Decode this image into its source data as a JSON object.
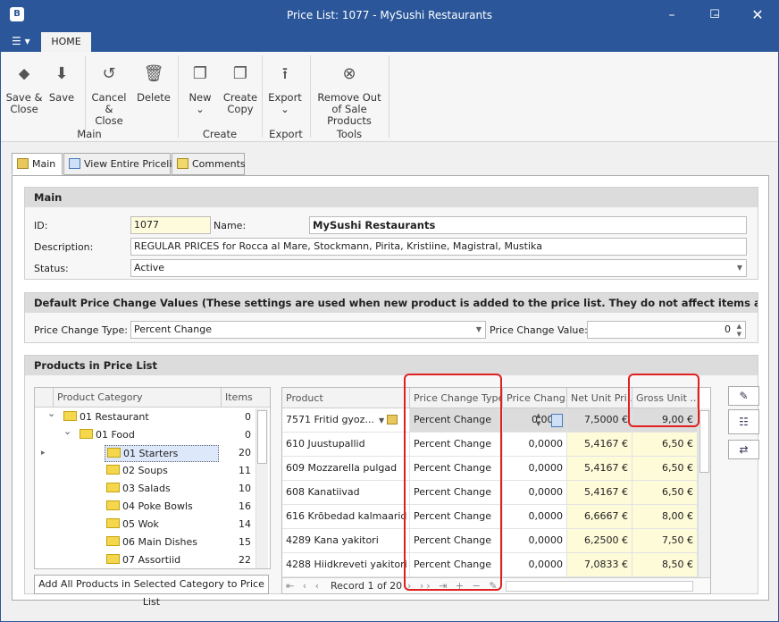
{
  "window": {
    "title": "Price List: 1077 - MySushi Restaurants",
    "app_icon": "B"
  },
  "ribbon": {
    "tab": "HOME",
    "buttons": {
      "save_close": "Save & Close",
      "save": "Save",
      "cancel_close": "Cancel & Close",
      "delete": "Delete",
      "new": "New",
      "create_copy": "Create Copy",
      "export": "Export",
      "remove_out_of_sale": "Remove Out of Sale Products"
    },
    "groups": {
      "main": "Main",
      "create": "Create",
      "export": "Export",
      "tools": "Tools"
    }
  },
  "tabs": [
    "Main",
    "View Entire Pricelist",
    "Comments"
  ],
  "main_group": {
    "title": "Main",
    "id_label": "ID:",
    "id_value": "1077",
    "name_label": "Name:",
    "name_value": "MySushi Restaurants",
    "description_label": "Description:",
    "description_value": "REGULAR PRICES for Rocca al Mare, Stockmann, Pirita, Kristiine, Magistral, Mustika",
    "status_label": "Status:",
    "status_value": "Active"
  },
  "defaults_group": {
    "title": "Default Price Change Values (These settings are used when new product is added to the price list. They do not affect items already in the price",
    "type_label": "Price Change Type:",
    "type_value": "Percent Change",
    "value_label": "Price Change Value:",
    "value_value": "0"
  },
  "products_group": {
    "title": "Products in Price List",
    "tree": {
      "headers": {
        "category": "Product Category",
        "items": "Items"
      },
      "rows": [
        {
          "name": "01 Restaurant",
          "count": "0"
        },
        {
          "name": "01 Food",
          "count": "0"
        },
        {
          "name": "01 Starters",
          "count": "20"
        },
        {
          "name": "02 Soups",
          "count": "11"
        },
        {
          "name": "03 Salads",
          "count": "10"
        },
        {
          "name": "04 Poke Bowls",
          "count": "16"
        },
        {
          "name": "05 Wok",
          "count": "14"
        },
        {
          "name": "06 Main Dishes",
          "count": "15"
        },
        {
          "name": "07 Assortiid",
          "count": "22"
        }
      ]
    },
    "add_button": "Add All Products in Selected Category to Price List",
    "grid": {
      "headers": [
        "Product",
        "Price Change Type",
        "Price Chang...",
        "Net Unit Pri...",
        "Gross Unit ..."
      ],
      "rows": [
        {
          "product": "7571 Fritid gyoz...",
          "type": "Percent Change",
          "change": "0,00...",
          "net": "7,5000 €",
          "gross": "9,00 €"
        },
        {
          "product": "610 Juustupallid",
          "type": "Percent Change",
          "change": "0,0000",
          "net": "5,4167 €",
          "gross": "6,50 €"
        },
        {
          "product": "609 Mozzarella pulgad",
          "type": "Percent Change",
          "change": "0,0000",
          "net": "5,4167 €",
          "gross": "6,50 €"
        },
        {
          "product": "608 Kanatiivad",
          "type": "Percent Change",
          "change": "0,0000",
          "net": "5,4167 €",
          "gross": "6,50 €"
        },
        {
          "product": "616 Krõbedad kalmaarid",
          "type": "Percent Change",
          "change": "0,0000",
          "net": "6,6667 €",
          "gross": "8,00 €"
        },
        {
          "product": "4289 Kana yakitori",
          "type": "Percent Change",
          "change": "0,0000",
          "net": "6,2500 €",
          "gross": "7,50 €"
        },
        {
          "product": "4288 Hiidkreveti yakitori",
          "type": "Percent Change",
          "change": "0,0000",
          "net": "7,0833 €",
          "gross": "8,50 €"
        }
      ],
      "record": "Record 1 of 20"
    }
  }
}
